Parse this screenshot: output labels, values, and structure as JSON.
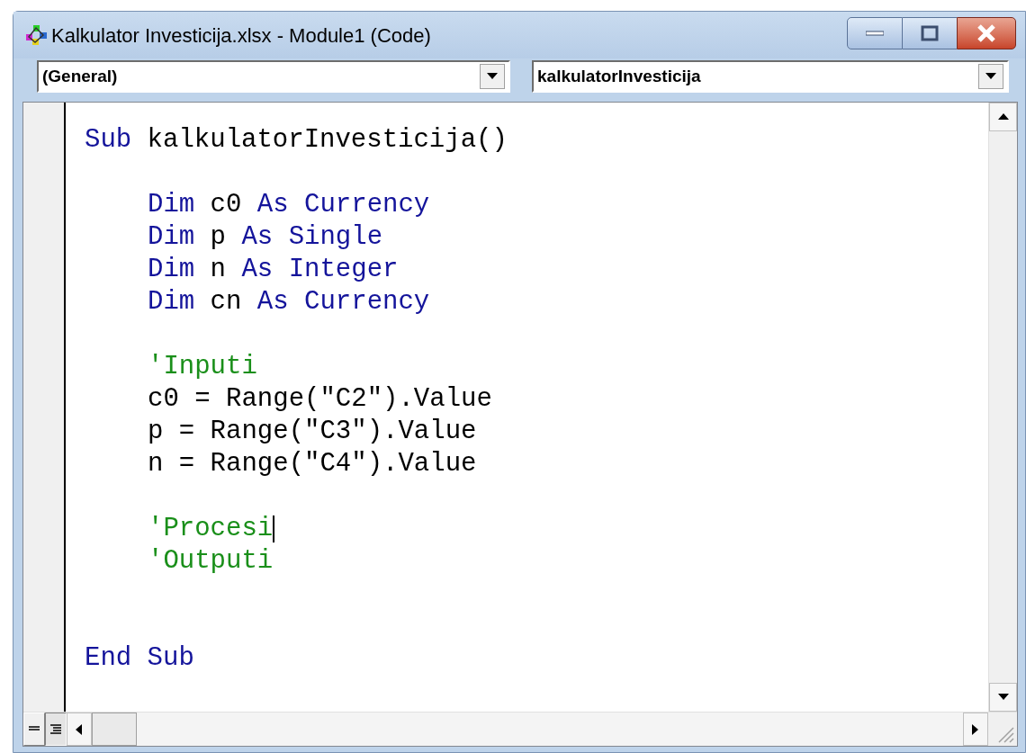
{
  "window": {
    "title": "Kalkulator Investicija.xlsx - Module1 (Code)"
  },
  "object_dropdown": {
    "value": "(General)"
  },
  "procedure_dropdown": {
    "value": "kalkulatorInvesticija"
  },
  "code_lines": [
    {
      "indent": false,
      "cursor": false,
      "tokens": [
        {
          "kind": "keyword",
          "text": "Sub"
        },
        {
          "kind": "plain",
          "text": " kalkulatorInvesticija()"
        }
      ]
    },
    {
      "cursor": false
    },
    {
      "indent": true,
      "cursor": false,
      "tokens": [
        {
          "kind": "keyword",
          "text": "Dim"
        },
        {
          "kind": "plain",
          "text": " c0 "
        },
        {
          "kind": "keyword",
          "text": "As Currency"
        }
      ]
    },
    {
      "indent": true,
      "cursor": false,
      "tokens": [
        {
          "kind": "keyword",
          "text": "Dim"
        },
        {
          "kind": "plain",
          "text": " p "
        },
        {
          "kind": "keyword",
          "text": "As Single"
        }
      ]
    },
    {
      "indent": true,
      "cursor": false,
      "tokens": [
        {
          "kind": "keyword",
          "text": "Dim"
        },
        {
          "kind": "plain",
          "text": " n "
        },
        {
          "kind": "keyword",
          "text": "As Integer"
        }
      ]
    },
    {
      "indent": true,
      "cursor": false,
      "tokens": [
        {
          "kind": "keyword",
          "text": "Dim"
        },
        {
          "kind": "plain",
          "text": " cn "
        },
        {
          "kind": "keyword",
          "text": "As Currency"
        }
      ]
    },
    {
      "cursor": false
    },
    {
      "indent": true,
      "cursor": false,
      "tokens": [
        {
          "kind": "comment",
          "text": "'Inputi"
        }
      ]
    },
    {
      "indent": true,
      "cursor": false,
      "tokens": [
        {
          "kind": "plain",
          "text": "c0 = Range(\"C2\").Value"
        }
      ]
    },
    {
      "indent": true,
      "cursor": false,
      "tokens": [
        {
          "kind": "plain",
          "text": "p = Range(\"C3\").Value"
        }
      ]
    },
    {
      "indent": true,
      "cursor": false,
      "tokens": [
        {
          "kind": "plain",
          "text": "n = Range(\"C4\").Value"
        }
      ]
    },
    {
      "cursor": false
    },
    {
      "indent": true,
      "cursor": true,
      "tokens": [
        {
          "kind": "comment",
          "text": "'Procesi"
        }
      ]
    },
    {
      "indent": true,
      "cursor": false,
      "tokens": [
        {
          "kind": "comment",
          "text": "'Outputi"
        }
      ]
    },
    {
      "cursor": false
    },
    {
      "cursor": false
    },
    {
      "indent": false,
      "cursor": false,
      "tokens": [
        {
          "kind": "keyword",
          "text": "End Sub"
        }
      ]
    }
  ],
  "view_buttons": [
    {
      "kind": "procedure",
      "selected": false
    },
    {
      "kind": "module",
      "selected": true
    }
  ]
}
